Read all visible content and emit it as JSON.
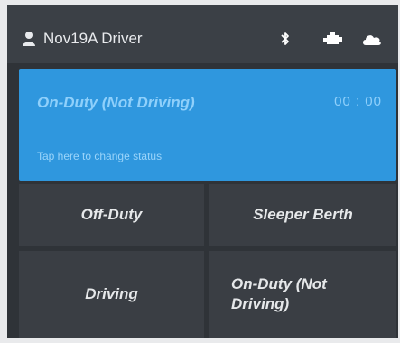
{
  "header": {
    "driver_name": "Nov19A Driver",
    "icons": [
      "user-icon",
      "bluetooth-icon",
      "truck-engine-icon",
      "cloud-icon"
    ]
  },
  "status_card": {
    "current_status": "On-Duty (Not Driving)",
    "timer": "00 : 00",
    "hint": "Tap here to change status"
  },
  "status_buttons": {
    "off_duty": "Off-Duty",
    "sleeper_berth": "Sleeper Berth",
    "driving": "Driving",
    "on_duty_not_driving": "On-Duty (Not Driving)"
  },
  "colors": {
    "accent": "#2f97de",
    "panel": "#2f3338",
    "button": "#3a3e44",
    "status_text": "#8fd0fb"
  }
}
